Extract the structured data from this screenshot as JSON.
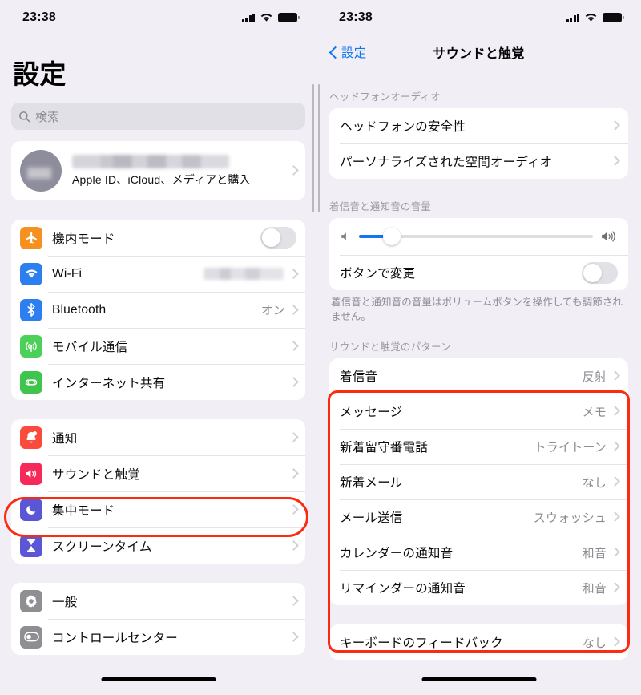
{
  "colors": {
    "page_bg": "#f1eff5",
    "card_bg": "#ffffff",
    "accent_blue": "#1176f3",
    "highlight_red": "#fc2a10",
    "secondary_text": "#8c8c93"
  },
  "left": {
    "status": {
      "time": "23:38",
      "signal": "cellular-bars-icon",
      "wifi": "wifi-icon",
      "battery": "battery-full-icon"
    },
    "title": "設定",
    "search": {
      "placeholder": "検索",
      "icon": "search-icon"
    },
    "account": {
      "name_redacted": "",
      "subtitle": "Apple ID、iCloud、メディアと購入"
    },
    "groups": [
      {
        "rows": [
          {
            "label": "機内モード",
            "icon": "airplane-icon",
            "color": "#f6901e",
            "control": "toggle",
            "toggle_on": false
          },
          {
            "label": "Wi-Fi",
            "icon": "wifi-icon",
            "color": "#2d7ff0",
            "value_redacted": true,
            "control": "chevron"
          },
          {
            "label": "Bluetooth",
            "icon": "bluetooth-icon",
            "color": "#2d7ff0",
            "value": "オン",
            "control": "chevron"
          },
          {
            "label": "モバイル通信",
            "icon": "cellular-antenna-icon",
            "color": "#4cd05a",
            "value": "",
            "control": "chevron"
          },
          {
            "label": "インターネット共有",
            "icon": "hotspot-link-icon",
            "color": "#3fc44d",
            "value": "",
            "control": "chevron"
          }
        ]
      },
      {
        "rows": [
          {
            "label": "通知",
            "icon": "bell-icon",
            "color": "#fa4b3c",
            "value": "",
            "control": "chevron"
          },
          {
            "label": "サウンドと触覚",
            "icon": "speaker-waves-icon",
            "color": "#f6295a",
            "value": "",
            "control": "chevron",
            "highlighted": true
          },
          {
            "label": "集中モード",
            "icon": "moon-icon",
            "color": "#5a56d6",
            "value": "",
            "control": "chevron"
          },
          {
            "label": "スクリーンタイム",
            "icon": "hourglass-icon",
            "color": "#5a56d6",
            "value": "",
            "control": "chevron"
          }
        ]
      },
      {
        "rows": [
          {
            "label": "一般",
            "icon": "gear-icon",
            "color": "#8e8e93",
            "value": "",
            "control": "chevron"
          },
          {
            "label": "コントロールセンター",
            "icon": "toggle-switch-icon",
            "color": "#8e8e93",
            "value": "",
            "control": "chevron"
          }
        ]
      }
    ]
  },
  "right": {
    "status": {
      "time": "23:38",
      "signal": "cellular-bars-icon",
      "wifi": "wifi-icon",
      "battery": "battery-full-icon"
    },
    "nav": {
      "back_label": "設定",
      "back_icon": "chevron-left-icon",
      "title": "サウンドと触覚"
    },
    "sections": [
      {
        "header": "ヘッドフォンオーディオ",
        "rows": [
          {
            "label": "ヘッドフォンの安全性",
            "value": "",
            "control": "chevron"
          },
          {
            "label": "パーソナライズされた空間オーディオ",
            "value": "",
            "control": "chevron"
          }
        ]
      },
      {
        "header": "着信音と通知音の音量",
        "slider": {
          "value_percent": 14,
          "min_icon": "speaker-low-icon",
          "max_icon": "speaker-high-icon"
        },
        "rows": [
          {
            "label": "ボタンで変更",
            "control": "toggle",
            "toggle_on": false
          }
        ],
        "footer": "着信音と通知音の音量はボリュームボタンを操作しても調節されません。"
      },
      {
        "header": "サウンドと触覚のパターン",
        "highlighted": true,
        "rows": [
          {
            "label": "着信音",
            "value": "反射",
            "control": "chevron"
          },
          {
            "label": "メッセージ",
            "value": "メモ",
            "control": "chevron"
          },
          {
            "label": "新着留守番電話",
            "value": "トライトーン",
            "control": "chevron"
          },
          {
            "label": "新着メール",
            "value": "なし",
            "control": "chevron"
          },
          {
            "label": "メール送信",
            "value": "スウォッシュ",
            "control": "chevron"
          },
          {
            "label": "カレンダーの通知音",
            "value": "和音",
            "control": "chevron"
          },
          {
            "label": "リマインダーの通知音",
            "value": "和音",
            "control": "chevron"
          }
        ]
      },
      {
        "header": "",
        "rows": [
          {
            "label": "キーボードのフィードバック",
            "value": "なし",
            "control": "chevron"
          }
        ]
      }
    ]
  }
}
